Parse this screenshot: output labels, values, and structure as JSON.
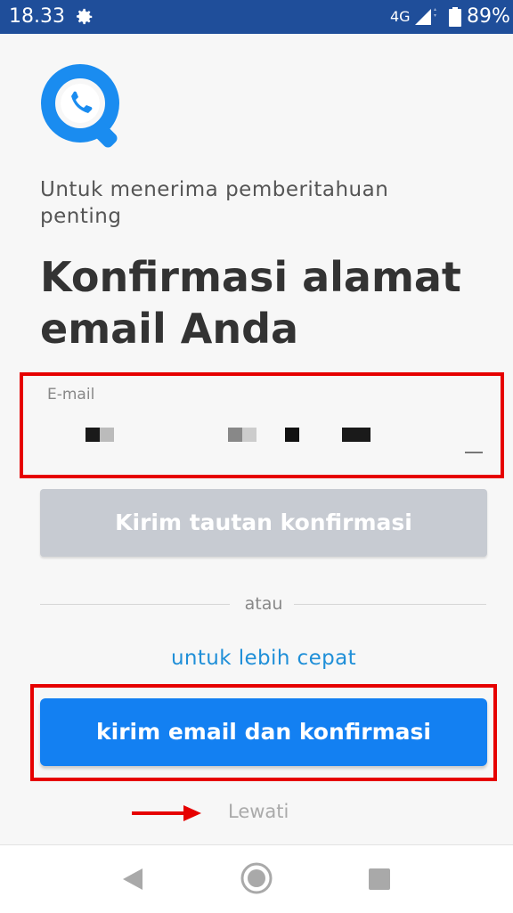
{
  "status_bar": {
    "time": "18.33",
    "network": "4G",
    "battery": "89%",
    "icons": [
      "gear-icon",
      "signal-icon",
      "battery-icon"
    ]
  },
  "app": {
    "logo_icon": "phone-search-logo",
    "subtitle": "Untuk menerima pemberitahuan penting",
    "title": "Konfirmasi alamat email Anda"
  },
  "email_field": {
    "label": "E-mail",
    "value_redacted": true
  },
  "buttons": {
    "send_link": "Kirim tautan konfirmasi",
    "send_email_confirm": "kirim email dan konfirmasi"
  },
  "divider": {
    "text": "atau"
  },
  "faster_text": "untuk lebih cepat",
  "skip": {
    "label": "Lewati"
  },
  "nav_bar": {
    "icons": [
      "back-icon",
      "home-icon",
      "recent-apps-icon"
    ]
  },
  "colors": {
    "status_bar": "#1f4e9a",
    "primary": "#1380f2",
    "disabled": "#c7cbd2",
    "highlight": "#e60000",
    "link": "#1f8fd8"
  }
}
